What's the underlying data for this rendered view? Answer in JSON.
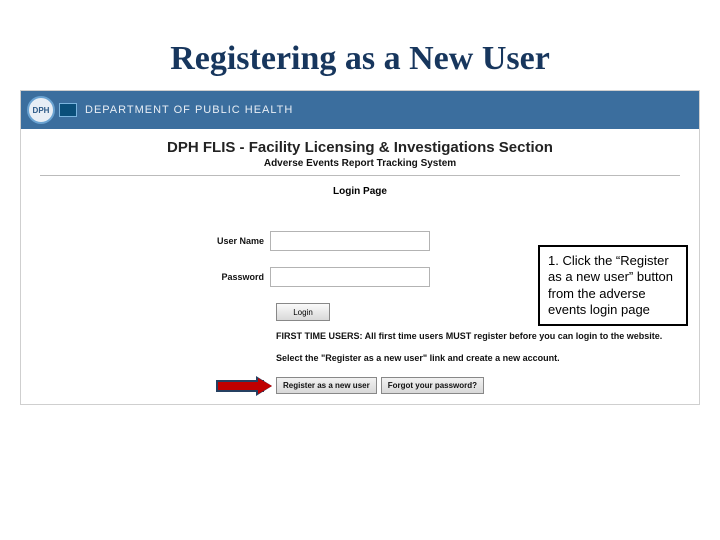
{
  "title": "Registering as a New User",
  "header": {
    "logo_text": "DPH",
    "department": "DEPARTMENT OF PUBLIC HEALTH"
  },
  "app": {
    "title": "DPH FLIS - Facility Licensing & Investigations Section",
    "subtitle": "Adverse Events Report Tracking System",
    "login_title": "Login Page",
    "username_label": "User Name",
    "password_label": "Password",
    "login_btn": "Login",
    "hint1": "FIRST TIME USERS: All first time users MUST register before you can login to the website.",
    "hint2": "Select the \"Register as a new user\" link and create a new account.",
    "register_link": "Register as a new user",
    "forgot_link": "Forgot your password?"
  },
  "callout": {
    "text": "1. Click the “Register as a new user” button from the adverse events login page"
  }
}
